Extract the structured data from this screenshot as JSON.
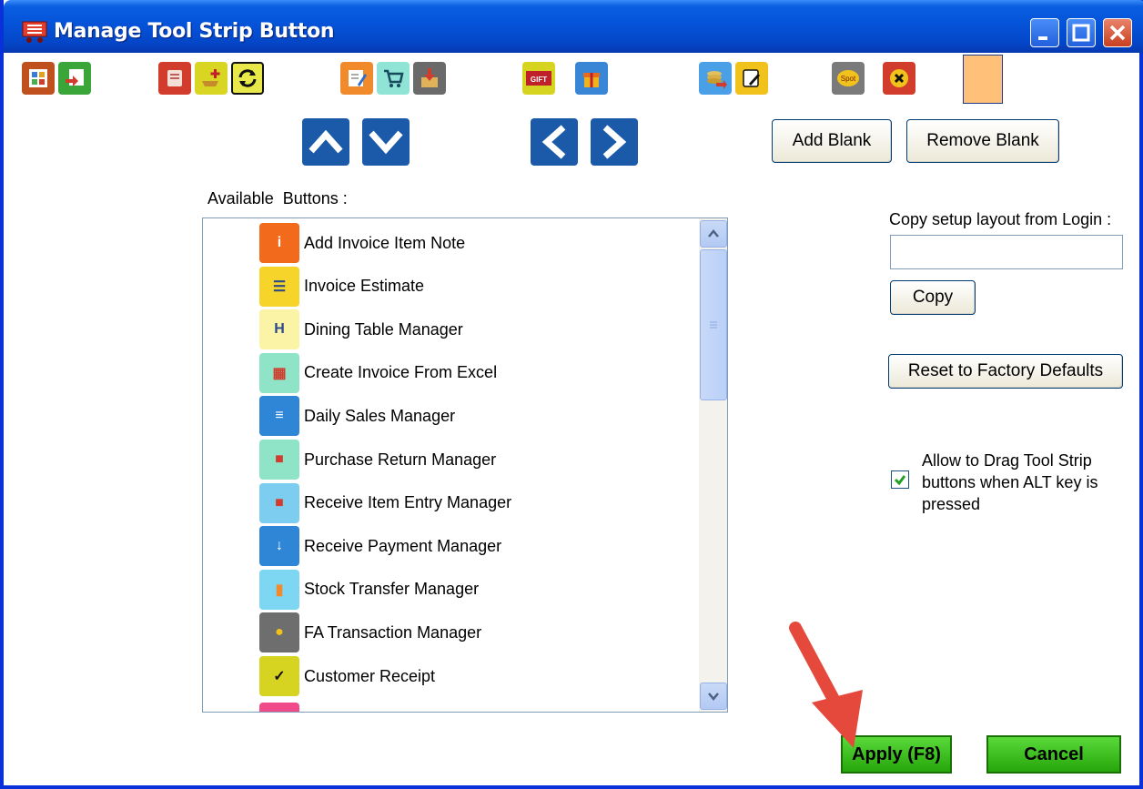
{
  "window": {
    "title": "Manage Tool Strip Button"
  },
  "toolstrip": {
    "icons": [
      "layout-icon",
      "report-export-icon",
      "scroll-icon",
      "add-item-icon",
      "refresh-icon",
      "edit-note-icon",
      "cart-icon",
      "box-download-icon",
      "gift-card-icon",
      "gift-box-icon",
      "money-transfer-icon",
      "edit-pad-icon",
      "spot-icon",
      "close-x-icon",
      "blank-slot-icon"
    ],
    "gift_label": "GIFT",
    "spot_label": "Spot"
  },
  "buttons": {
    "add_blank": "Add Blank",
    "remove_blank": "Remove Blank",
    "copy": "Copy",
    "reset_defaults": "Reset to Factory Defaults",
    "apply": "Apply (F8)",
    "cancel": "Cancel"
  },
  "labels": {
    "available_buttons": "Available  Buttons :",
    "copy_setup": "Copy setup layout from Login :",
    "allow_drag": "Allow to Drag Tool Strip buttons when ALT key is pressed"
  },
  "copy_field": {
    "value": ""
  },
  "allow_drag_checked": true,
  "available_list": [
    {
      "label": "Add Invoice Item Note",
      "icon": "info-icon",
      "color": "#f26b1d"
    },
    {
      "label": "Invoice Estimate",
      "icon": "estimate-icon",
      "color": "#f6d42a"
    },
    {
      "label": "Dining Table Manager",
      "icon": "dining-table-icon",
      "color": "#fbf3a6"
    },
    {
      "label": "Create Invoice From Excel",
      "icon": "excel-icon",
      "color": "#8fe4c8"
    },
    {
      "label": "Daily Sales Manager",
      "icon": "daily-sales-icon",
      "color": "#2f86d6"
    },
    {
      "label": "Purchase Return Manager",
      "icon": "truck-return-icon",
      "color": "#8fe4c8"
    },
    {
      "label": "Receive Item Entry Manager",
      "icon": "truck-icon",
      "color": "#7dcdf0"
    },
    {
      "label": "Receive Payment Manager",
      "icon": "download-icon",
      "color": "#2f86d6"
    },
    {
      "label": "Stock Transfer Manager",
      "icon": "stock-transfer-icon",
      "color": "#7dd7f2"
    },
    {
      "label": "FA Transaction Manager",
      "icon": "coins-icon",
      "color": "#6e6e6e"
    },
    {
      "label": "Customer Receipt",
      "icon": "receipt-check-icon",
      "color": "#d6d321"
    }
  ]
}
